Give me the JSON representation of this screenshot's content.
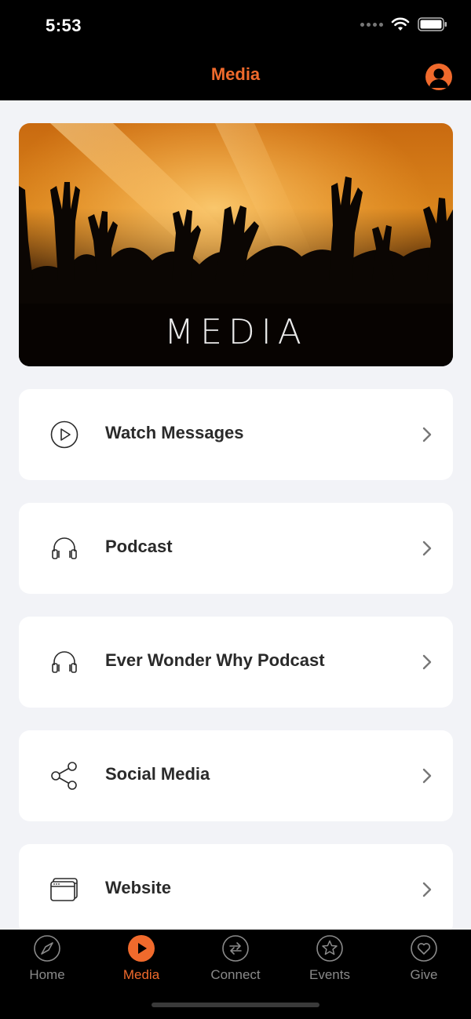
{
  "status_bar": {
    "time": "5:53"
  },
  "nav": {
    "title": "Media"
  },
  "hero": {
    "label": "MEDIA"
  },
  "menu": [
    {
      "label": "Watch Messages",
      "icon": "play-circle-icon"
    },
    {
      "label": "Podcast",
      "icon": "headphones-icon"
    },
    {
      "label": "Ever Wonder Why Podcast",
      "icon": "headphones-icon"
    },
    {
      "label": "Social Media",
      "icon": "share-icon"
    },
    {
      "label": "Website",
      "icon": "browser-window-icon"
    }
  ],
  "tabs": [
    {
      "label": "Home",
      "icon": "compass-icon",
      "active": false
    },
    {
      "label": "Media",
      "icon": "play-icon",
      "active": true
    },
    {
      "label": "Connect",
      "icon": "exchange-icon",
      "active": false
    },
    {
      "label": "Events",
      "icon": "star-icon",
      "active": false
    },
    {
      "label": "Give",
      "icon": "heart-icon",
      "active": false
    }
  ],
  "colors": {
    "accent": "#f06a2c",
    "background": "#f2f3f7",
    "card": "#ffffff",
    "bar": "#000000"
  }
}
